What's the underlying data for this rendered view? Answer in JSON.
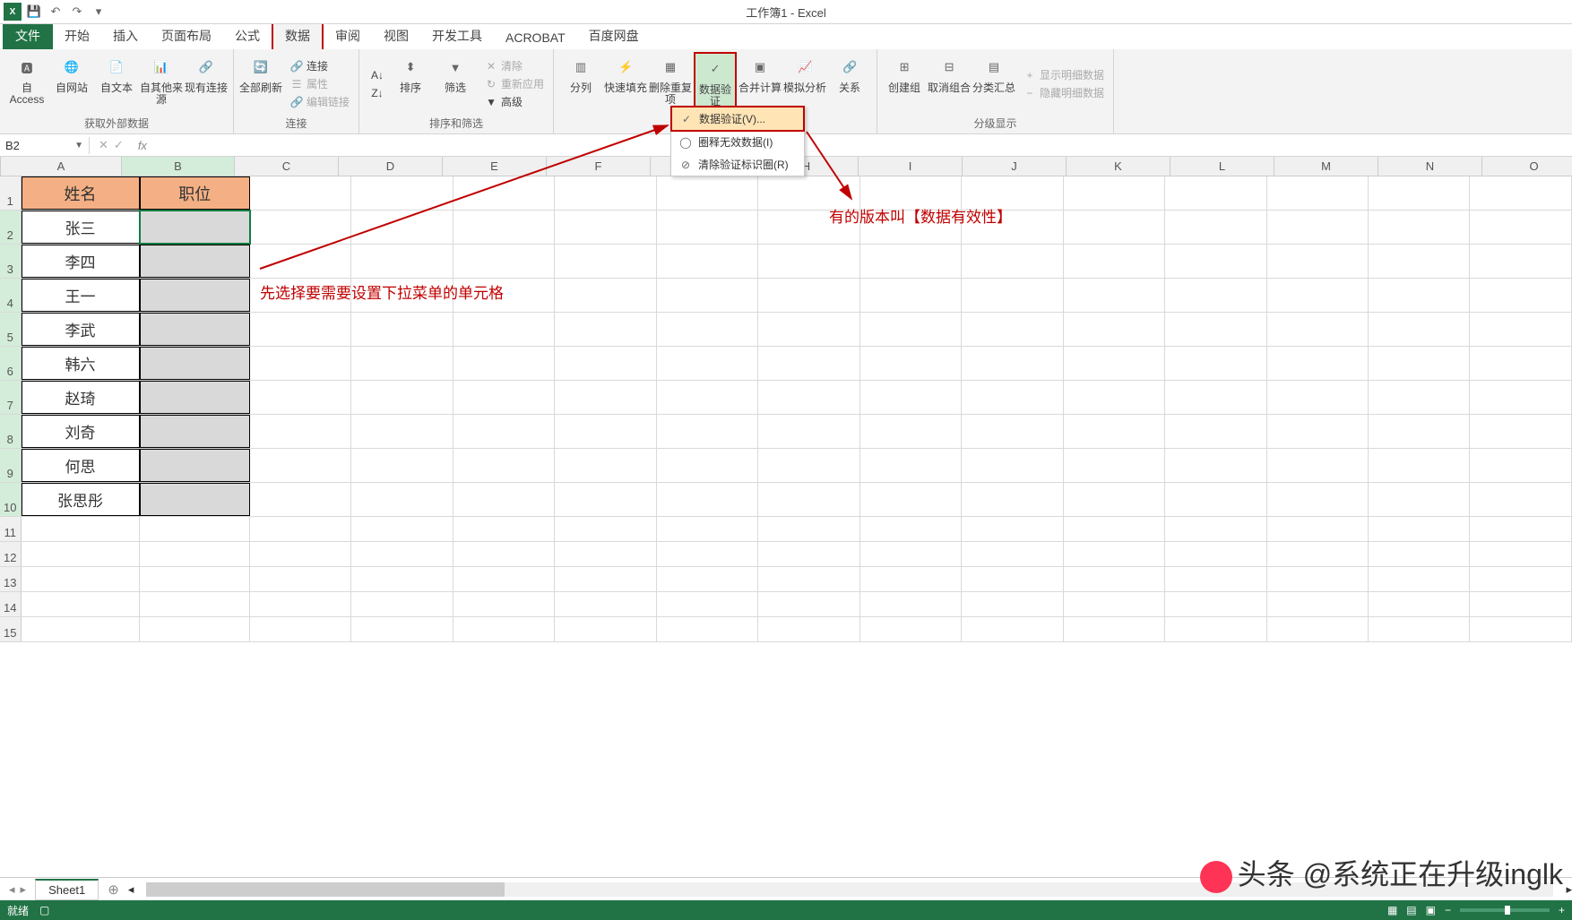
{
  "title": "工作簿1 - Excel",
  "qat": {
    "save": "保存",
    "undo": "撤销",
    "redo": "重做"
  },
  "tabs": {
    "file": "文件",
    "home": "开始",
    "insert": "插入",
    "layout": "页面布局",
    "formula": "公式",
    "data": "数据",
    "review": "审阅",
    "view": "视图",
    "developer": "开发工具",
    "acrobat": "ACROBAT",
    "baidu": "百度网盘"
  },
  "ribbon": {
    "ext": {
      "access": "自 Access",
      "web": "自网站",
      "text": "自文本",
      "other": "自其他来源",
      "existing": "现有连接",
      "group": "获取外部数据"
    },
    "conn": {
      "refresh": "全部刷新",
      "c1": "连接",
      "c2": "属性",
      "c3": "编辑链接",
      "group": "连接"
    },
    "sort": {
      "az": "A|Z",
      "za": "Z|A",
      "sort": "排序",
      "filter": "筛选",
      "clear": "清除",
      "reapply": "重新应用",
      "adv": "高级",
      "group": "排序和筛选"
    },
    "tools": {
      "col": "分列",
      "flash": "快速填充",
      "dup": "删除重复项",
      "valid": "数据验证",
      "cons": "合并计算",
      "what": "模拟分析",
      "rel": "关系"
    },
    "outline": {
      "grp": "创建组",
      "ungrp": "取消组合",
      "sub": "分类汇总",
      "show": "显示明细数据",
      "hide": "隐藏明细数据",
      "group": "分级显示"
    }
  },
  "dv_menu": {
    "m1": "数据验证(V)...",
    "m2": "圈释无效数据(I)",
    "m3": "清除验证标识圈(R)"
  },
  "name_box": "B2",
  "columns": [
    "A",
    "B",
    "C",
    "D",
    "E",
    "F",
    "G",
    "H",
    "I",
    "J",
    "K",
    "L",
    "M",
    "N",
    "O"
  ],
  "headers": {
    "A": "姓名",
    "B": "职位"
  },
  "rows": [
    {
      "n": 1
    },
    {
      "n": 2,
      "A": "张三"
    },
    {
      "n": 3,
      "A": "李四"
    },
    {
      "n": 4,
      "A": "王一"
    },
    {
      "n": 5,
      "A": "李武"
    },
    {
      "n": 6,
      "A": "韩六"
    },
    {
      "n": 7,
      "A": "赵琦"
    },
    {
      "n": 8,
      "A": "刘奇"
    },
    {
      "n": 9,
      "A": "何思"
    },
    {
      "n": 10,
      "A": "张思彤"
    },
    {
      "n": 11
    },
    {
      "n": 12
    },
    {
      "n": 13
    },
    {
      "n": 14
    },
    {
      "n": 15
    }
  ],
  "annot": {
    "a1": "先选择要需要设置下拉菜单的单元格",
    "a2": "有的版本叫【数据有效性】"
  },
  "sheet_tab": "Sheet1",
  "status": "就绪",
  "watermark": "头条 @系统正在升级inglk"
}
